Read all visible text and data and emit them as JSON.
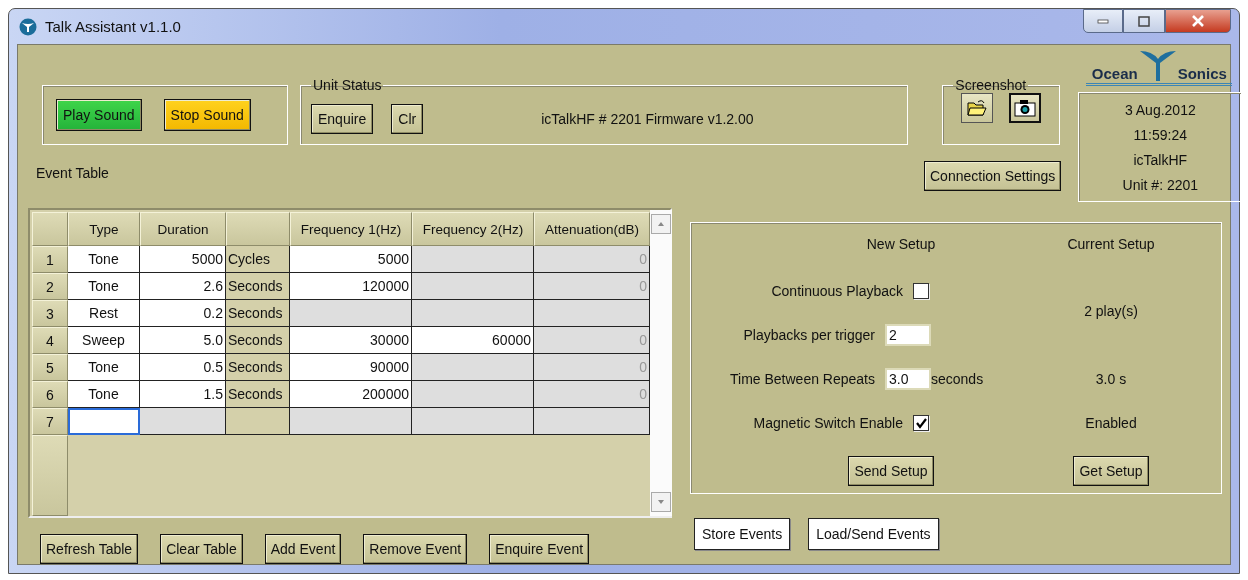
{
  "window": {
    "title": "Talk Assistant v1.1.0"
  },
  "sound_buttons": [
    {
      "label": "Play Sound",
      "kind": "play"
    },
    {
      "label": "Stop Sound",
      "kind": "stop"
    }
  ],
  "unit_status": {
    "legend": "Unit Status",
    "buttons": [
      "Enquire",
      "Clr"
    ],
    "status": "icTalkHF # 2201 Firmware v1.2.00"
  },
  "screenshot": {
    "legend": "Screenshot"
  },
  "connection_button": "Connection Settings",
  "logo": {
    "left": "Ocean",
    "right": "Sonics"
  },
  "info": [
    "3 Aug.2012",
    "11:59:24",
    "icTalkHF",
    "Unit #: 2201"
  ],
  "event_table": {
    "label": "Event Table",
    "columns": [
      "Type",
      "Duration",
      "",
      "Frequency 1(Hz)",
      "Frequency 2(Hz)",
      "Attenuation(dB)"
    ],
    "rows": [
      {
        "number": "1",
        "cells": [
          {
            "text": "Tone",
            "disabled": false,
            "selected": false
          },
          {
            "text": "5000",
            "disabled": false,
            "selected": false
          },
          {
            "text": "Cycles",
            "selected": false
          },
          {
            "text": "5000",
            "disabled": false,
            "selected": false
          },
          {
            "disabled": true,
            "selected": false
          },
          {
            "text": "0",
            "disabled": true,
            "selected": false
          }
        ]
      },
      {
        "number": "2",
        "cells": [
          {
            "text": "Tone",
            "disabled": false,
            "selected": false
          },
          {
            "text": "2.6",
            "disabled": false,
            "selected": false
          },
          {
            "text": "Seconds",
            "selected": false
          },
          {
            "text": "120000",
            "disabled": false,
            "selected": false
          },
          {
            "disabled": true,
            "selected": false
          },
          {
            "text": "0",
            "disabled": true,
            "selected": false
          }
        ]
      },
      {
        "number": "3",
        "cells": [
          {
            "text": "Rest",
            "disabled": false,
            "selected": false
          },
          {
            "text": "0.2",
            "disabled": false,
            "selected": false
          },
          {
            "text": "Seconds",
            "selected": false
          },
          {
            "disabled": true,
            "selected": false
          },
          {
            "disabled": true,
            "selected": false
          },
          {
            "disabled": true,
            "selected": false
          }
        ]
      },
      {
        "number": "4",
        "cells": [
          {
            "text": "Sweep",
            "disabled": false,
            "selected": false
          },
          {
            "text": "5.0",
            "disabled": false,
            "selected": false
          },
          {
            "text": "Seconds",
            "selected": false
          },
          {
            "text": "30000",
            "disabled": false,
            "selected": false
          },
          {
            "text": "60000",
            "disabled": false,
            "selected": false
          },
          {
            "text": "0",
            "disabled": true,
            "selected": false
          }
        ]
      },
      {
        "number": "5",
        "cells": [
          {
            "text": "Tone",
            "disabled": false,
            "selected": false
          },
          {
            "text": "0.5",
            "disabled": false,
            "selected": false
          },
          {
            "text": "Seconds",
            "selected": false
          },
          {
            "text": "90000",
            "disabled": false,
            "selected": false
          },
          {
            "disabled": true,
            "selected": false
          },
          {
            "text": "0",
            "disabled": true,
            "selected": false
          }
        ]
      },
      {
        "number": "6",
        "cells": [
          {
            "text": "Tone",
            "disabled": false,
            "selected": false
          },
          {
            "text": "1.5",
            "disabled": false,
            "selected": false
          },
          {
            "text": "Seconds",
            "selected": false
          },
          {
            "text": "200000",
            "disabled": false,
            "selected": false
          },
          {
            "disabled": true,
            "selected": false
          },
          {
            "text": "0",
            "disabled": true,
            "selected": false
          }
        ]
      },
      {
        "number": "7",
        "cells": [
          {
            "disabled": false,
            "selected": true
          },
          {
            "disabled": true,
            "selected": false
          },
          {
            "selected": false
          },
          {
            "disabled": true,
            "selected": false
          },
          {
            "disabled": true,
            "selected": false
          },
          {
            "disabled": true,
            "selected": false
          }
        ]
      }
    ]
  },
  "table_buttons": [
    "Refresh Table",
    "Clear Table",
    "Add Event",
    "Remove Event",
    "Enquire Event"
  ],
  "setup": {
    "new_heading": "New Setup",
    "current_heading": "Current Setup",
    "settings": [
      {
        "kind": "checkbox",
        "label": "Continuous Playback",
        "checked": false
      },
      {
        "kind": "input",
        "label": "Playbacks per trigger",
        "value": "2",
        "current": "2 play(s)"
      },
      {
        "kind": "input",
        "label": "Time Between Repeats",
        "value": "3.0",
        "unit": "seconds",
        "current": "3.0 s"
      },
      {
        "kind": "checkbox",
        "label": "Magnetic Switch Enable",
        "checked": true,
        "current": "Enabled"
      }
    ],
    "send_button": "Send Setup",
    "get_button": "Get Setup"
  },
  "event_buttons": [
    "Store Events",
    "Load/Send Events"
  ]
}
